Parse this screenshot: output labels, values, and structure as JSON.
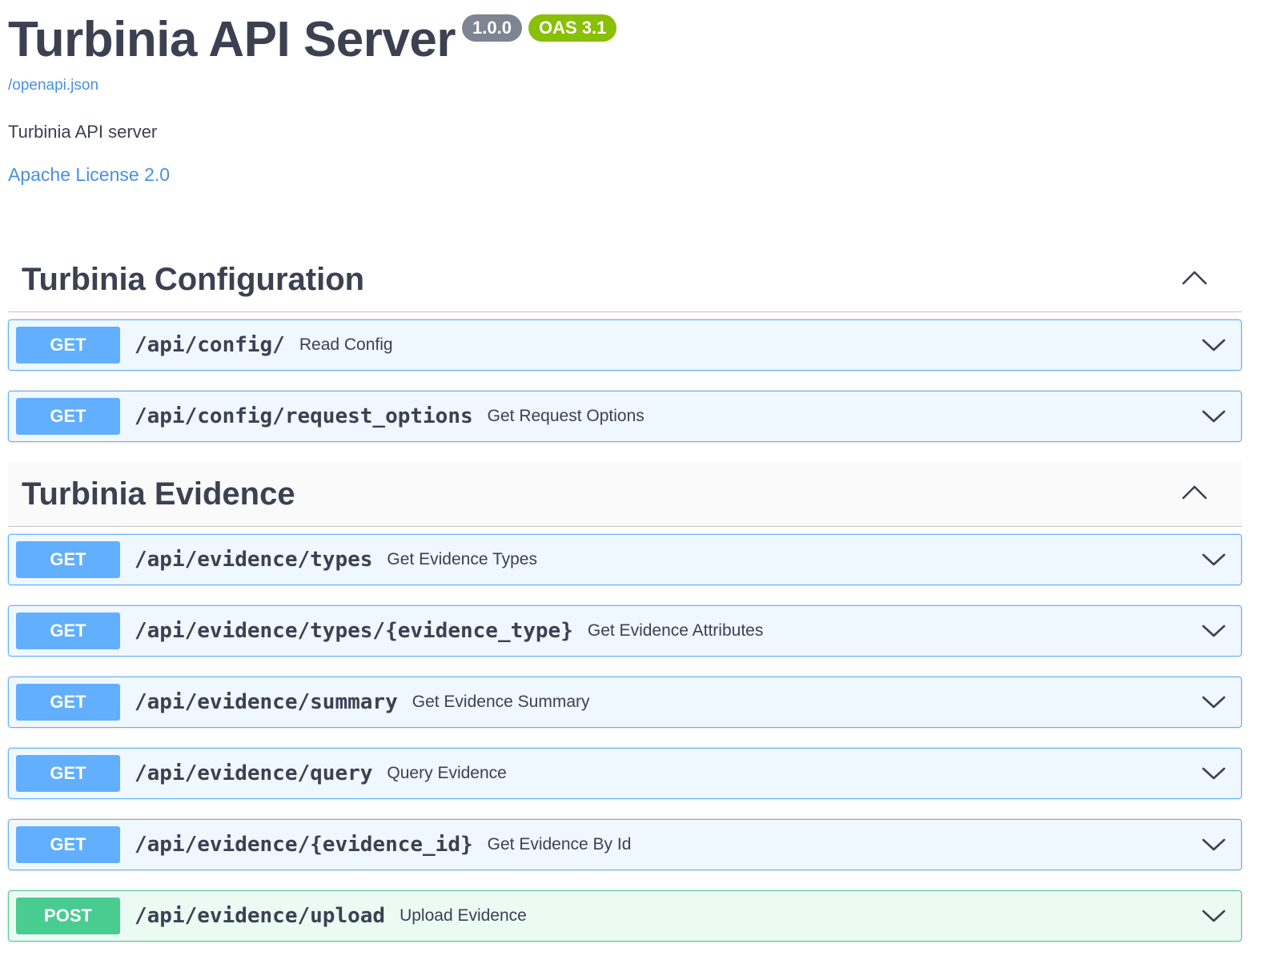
{
  "info": {
    "title": "Turbinia API Server",
    "version": "1.0.0",
    "oas": "OAS 3.1",
    "spec_link": "/openapi.json",
    "description": "Turbinia API server",
    "license": "Apache License 2.0"
  },
  "colors": {
    "get": "#61affe",
    "post": "#49cc90",
    "link": "#4990e2",
    "text": "#3b4151",
    "version_badge": "#7d8492",
    "oas_badge": "#89bf04"
  },
  "tags": [
    {
      "name": "Turbinia Configuration",
      "toggle_icon": "chevron-up-icon",
      "operations": [
        {
          "method": "GET",
          "path": "/api/config/",
          "summary": "Read Config"
        },
        {
          "method": "GET",
          "path": "/api/config/request_options",
          "summary": "Get Request Options"
        }
      ]
    },
    {
      "name": "Turbinia Evidence",
      "toggle_icon": "chevron-up-icon",
      "operations": [
        {
          "method": "GET",
          "path": "/api/evidence/types",
          "summary": "Get Evidence Types"
        },
        {
          "method": "GET",
          "path": "/api/evidence/types/{evidence_type}",
          "summary": "Get Evidence Attributes"
        },
        {
          "method": "GET",
          "path": "/api/evidence/summary",
          "summary": "Get Evidence Summary"
        },
        {
          "method": "GET",
          "path": "/api/evidence/query",
          "summary": "Query Evidence"
        },
        {
          "method": "GET",
          "path": "/api/evidence/{evidence_id}",
          "summary": "Get Evidence By Id"
        },
        {
          "method": "POST",
          "path": "/api/evidence/upload",
          "summary": "Upload Evidence"
        }
      ]
    }
  ]
}
